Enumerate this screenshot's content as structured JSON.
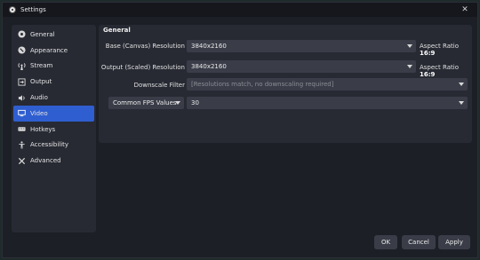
{
  "window": {
    "title": "Settings"
  },
  "sidebar": {
    "items": [
      {
        "label": "General",
        "icon": "gear-icon"
      },
      {
        "label": "Appearance",
        "icon": "paint-icon"
      },
      {
        "label": "Stream",
        "icon": "broadcast-icon"
      },
      {
        "label": "Output",
        "icon": "output-icon"
      },
      {
        "label": "Audio",
        "icon": "speaker-icon"
      },
      {
        "label": "Video",
        "icon": "monitor-icon",
        "active": true
      },
      {
        "label": "Hotkeys",
        "icon": "keyboard-icon"
      },
      {
        "label": "Accessibility",
        "icon": "accessibility-icon"
      },
      {
        "label": "Advanced",
        "icon": "wrench-icon"
      }
    ]
  },
  "general": {
    "title": "General",
    "base_label": "Base (Canvas) Resolution",
    "base_value": "3840x2160",
    "base_aspect_prefix": "Aspect Ratio",
    "base_aspect_value": "16:9",
    "output_label": "Output (Scaled) Resolution",
    "output_value": "3840x2160",
    "output_aspect_prefix": "Aspect Ratio",
    "output_aspect_value": "16:9",
    "downscale_label": "Downscale Filter",
    "downscale_value": "[Resolutions match, no downscaling required]",
    "fps_mode": "Common FPS Values",
    "fps_value": "30"
  },
  "buttons": {
    "ok": "OK",
    "cancel": "Cancel",
    "apply": "Apply"
  },
  "colors": {
    "active_item": "#2f5ed0",
    "panel": "#272a33",
    "input": "#3a3d48"
  }
}
